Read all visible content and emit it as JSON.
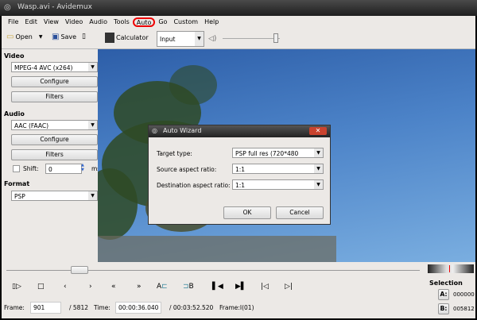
{
  "window": {
    "title": "Wasp.avi - Avidemux"
  },
  "menu": [
    "File",
    "Edit",
    "View",
    "Video",
    "Audio",
    "Tools",
    "Auto",
    "Go",
    "Custom",
    "Help"
  ],
  "toolbar": {
    "open": "Open",
    "save": "Save",
    "calculator": "Calculator",
    "display_mode": "Input",
    "volume": 0.95
  },
  "video": {
    "label": "Video",
    "codec": "MPEG-4 AVC (x264)",
    "configure": "Configure",
    "filters": "Filters"
  },
  "audio": {
    "label": "Audio",
    "codec": "AAC (FAAC)",
    "configure": "Configure",
    "filters": "Filters",
    "shift_label": "Shift:",
    "shift_value": "0",
    "shift_unit": "ms"
  },
  "format": {
    "label": "Format",
    "value": "PSP"
  },
  "dialog": {
    "title": "Auto Wizard",
    "target_label": "Target type:",
    "target_value": "PSP full res (720*480",
    "source_label": "Source aspect ratio:",
    "source_value": "1:1",
    "dest_label": "Destination aspect ratio:",
    "dest_value": "1:1",
    "ok": "OK",
    "cancel": "Cancel"
  },
  "playback": {
    "a_label": "A",
    "b_label": "B"
  },
  "status": {
    "frame_label": "Frame:",
    "frame_value": "901",
    "frame_total": "/ 5812",
    "time_label": "Time:",
    "time_value": "00:00:36.040",
    "time_total": "/ 00:03:52.520",
    "frame_type": "Frame:I(01)",
    "position": 0.155
  },
  "selection": {
    "label": "Selection",
    "a_btn": "A:",
    "a_value": "000000",
    "b_btn": "B:",
    "b_value": "005812"
  }
}
